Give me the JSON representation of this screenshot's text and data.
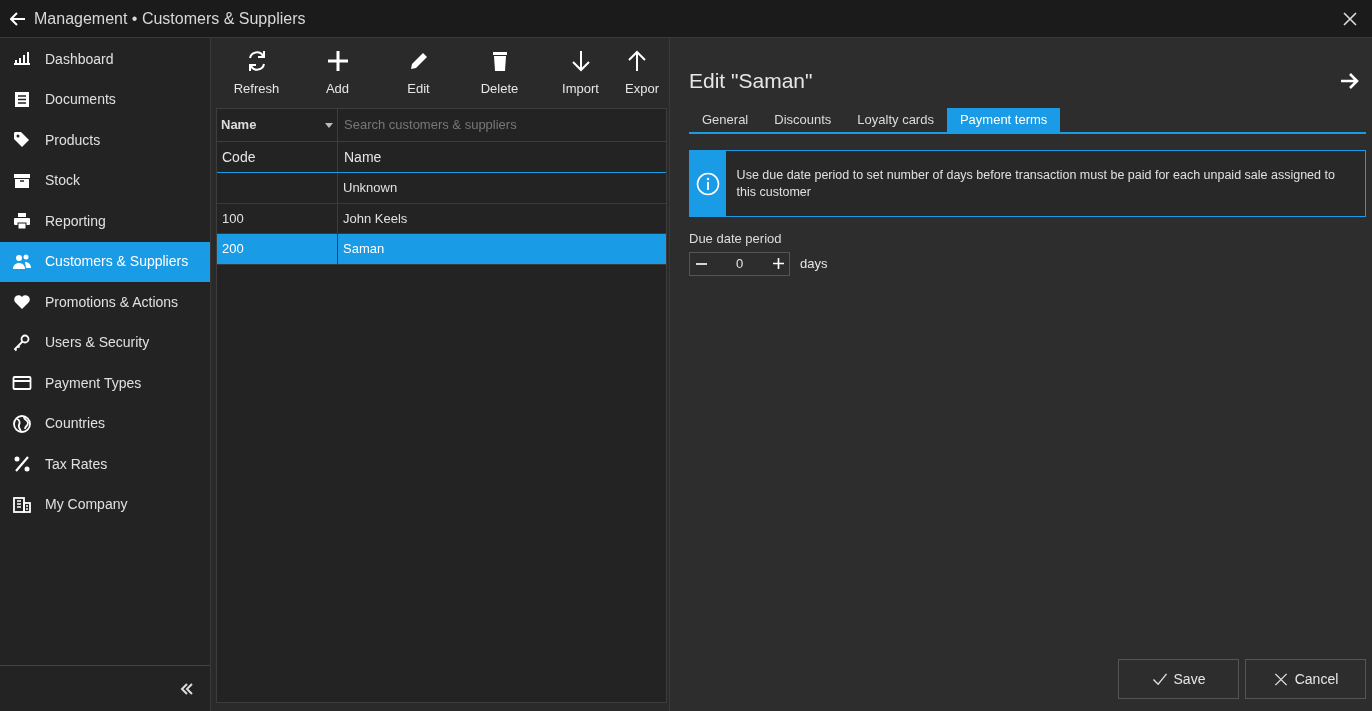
{
  "window": {
    "title": "Management • Customers & Suppliers"
  },
  "sidebar": {
    "items": [
      {
        "label": "Dashboard",
        "selected": false
      },
      {
        "label": "Documents",
        "selected": false
      },
      {
        "label": "Products",
        "selected": false
      },
      {
        "label": "Stock",
        "selected": false
      },
      {
        "label": "Reporting",
        "selected": false
      },
      {
        "label": "Customers & Suppliers",
        "selected": true
      },
      {
        "label": "Promotions & Actions",
        "selected": false
      },
      {
        "label": "Users & Security",
        "selected": false
      },
      {
        "label": "Payment Types",
        "selected": false
      },
      {
        "label": "Countries",
        "selected": false
      },
      {
        "label": "Tax Rates",
        "selected": false
      },
      {
        "label": "My Company",
        "selected": false
      }
    ]
  },
  "toolbar": [
    "Refresh",
    "Add",
    "Edit",
    "Delete",
    "Import",
    "Expor"
  ],
  "filter": {
    "field": "Name",
    "placeholder": "Search customers & suppliers"
  },
  "table": {
    "columns": [
      "Code",
      "Name"
    ],
    "rows": [
      {
        "cells": [
          "",
          "Unknown"
        ],
        "selected": false
      },
      {
        "cells": [
          "100",
          "John Keels"
        ],
        "selected": false
      },
      {
        "cells": [
          "200",
          "Saman"
        ],
        "selected": true
      }
    ]
  },
  "editor": {
    "title": "Edit \"Saman\"",
    "tabs": [
      {
        "label": "General",
        "selected": false
      },
      {
        "label": "Discounts",
        "selected": false
      },
      {
        "label": "Loyalty cards",
        "selected": false
      },
      {
        "label": "Payment terms",
        "selected": true
      }
    ],
    "info": "Use due date period to set number of days before transaction must be paid for each unpaid sale assigned to this customer",
    "field_label": "Due date period",
    "value": "0",
    "unit": "days"
  },
  "buttons": [
    "Save",
    "Cancel"
  ]
}
